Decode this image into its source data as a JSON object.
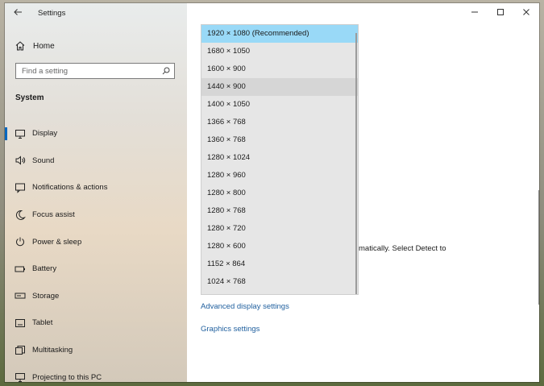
{
  "window": {
    "title": "Settings"
  },
  "sidebar": {
    "home_label": "Home",
    "search_placeholder": "Find a setting",
    "section_title": "System",
    "items": [
      {
        "label": "Display",
        "icon": "monitor-icon"
      },
      {
        "label": "Sound",
        "icon": "speaker-icon"
      },
      {
        "label": "Notifications & actions",
        "icon": "notification-icon"
      },
      {
        "label": "Focus assist",
        "icon": "moon-icon"
      },
      {
        "label": "Power & sleep",
        "icon": "power-icon"
      },
      {
        "label": "Battery",
        "icon": "battery-icon"
      },
      {
        "label": "Storage",
        "icon": "storage-icon"
      },
      {
        "label": "Tablet",
        "icon": "tablet-icon"
      },
      {
        "label": "Multitasking",
        "icon": "multitasking-icon"
      },
      {
        "label": "Projecting to this PC",
        "icon": "projecting-icon"
      }
    ],
    "selected_item": "Display"
  },
  "dropdown": {
    "options": [
      "1920 × 1080 (Recommended)",
      "1680 × 1050",
      "1600 × 900",
      "1440 × 900",
      "1400 × 1050",
      "1366 × 768",
      "1360 × 768",
      "1280 × 1024",
      "1280 × 960",
      "1280 × 800",
      "1280 × 768",
      "1280 × 720",
      "1280 × 600",
      "1152 × 864",
      "1024 × 768"
    ],
    "selected": "1920 × 1080 (Recommended)",
    "hovered": "1440 × 900"
  },
  "main": {
    "partial_text": "matically. Select Detect to",
    "advanced_link": "Advanced display settings",
    "graphics_link": "Graphics settings"
  },
  "colors": {
    "accent": "#0067c0",
    "selected_option": "#99d9f7",
    "link": "#1f5f9e"
  }
}
